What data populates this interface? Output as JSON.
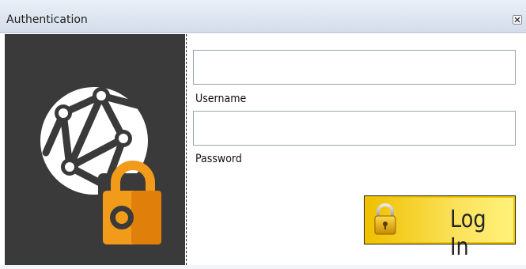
{
  "window": {
    "title": "Authentication"
  },
  "form": {
    "username": {
      "label": "Username",
      "value": "",
      "placeholder": ""
    },
    "password": {
      "label": "Password",
      "value": "",
      "placeholder": ""
    },
    "login_label": "Log In"
  },
  "icons": {
    "close": "close-icon",
    "globe": "network-globe-icon",
    "padlock": "padlock-icon",
    "button_lock": "lock-icon"
  },
  "colors": {
    "side_panel": "#3a3a3a",
    "accent_orange": "#f29a1a",
    "button_yellow": "#f2c500"
  }
}
